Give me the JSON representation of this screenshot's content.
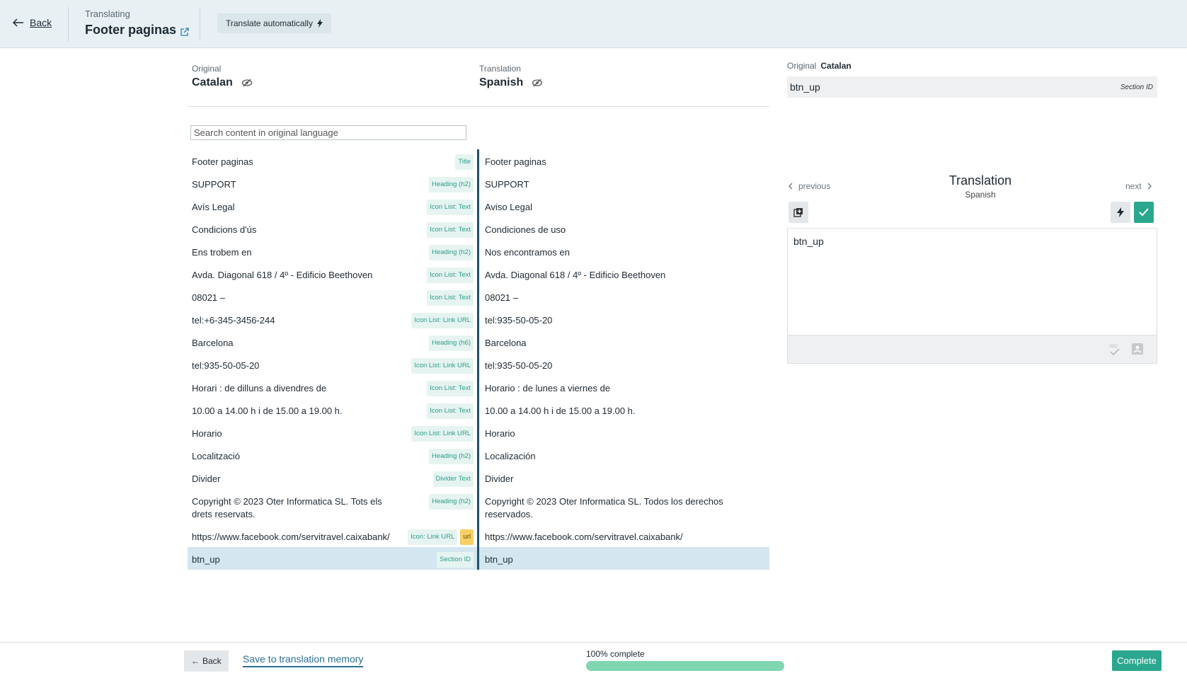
{
  "header": {
    "back_label": "Back",
    "subtitle": "Translating",
    "title": "Footer paginas",
    "translate_auto_label": "Translate automatically"
  },
  "columns": {
    "original_label": "Original",
    "original_lang": "Catalan",
    "translation_label": "Translation",
    "translation_lang": "Spanish"
  },
  "search": {
    "placeholder": "Search content in original language"
  },
  "rows": [
    {
      "original": "Footer paginas",
      "tags": [
        "Title"
      ],
      "translation": "Footer paginas"
    },
    {
      "original": "SUPPORT",
      "tags": [
        "Heading (h2)"
      ],
      "translation": "SUPPORT"
    },
    {
      "original": "Avís Legal",
      "tags": [
        "Icon List: Text"
      ],
      "translation": "Aviso Legal"
    },
    {
      "original": "Condicions d'ús",
      "tags": [
        "Icon List: Text"
      ],
      "translation": "Condiciones de uso"
    },
    {
      "original": "Ens trobem en",
      "tags": [
        "Heading (h2)"
      ],
      "translation": "Nos encontramos en"
    },
    {
      "original": "Avda. Diagonal 618 / 4º - Edificio Beethoven",
      "tags": [
        "Icon List: Text"
      ],
      "translation": "Avda. Diagonal 618 / 4º - Edificio Beethoven"
    },
    {
      "original": "08021 –",
      "tags": [
        "Icon List: Text"
      ],
      "translation": "08021 –"
    },
    {
      "original": "tel:+6-345-3456-244",
      "tags": [
        "Icon List: Link URL"
      ],
      "translation": "tel:935-50-05-20"
    },
    {
      "original": "Barcelona",
      "tags": [
        "Heading (h6)"
      ],
      "translation": "Barcelona"
    },
    {
      "original": "tel:935-50-05-20",
      "tags": [
        "Icon List: Link URL"
      ],
      "translation": "tel:935-50-05-20"
    },
    {
      "original": "Horari : de dilluns a divendres de",
      "tags": [
        "Icon List: Text"
      ],
      "translation": "Horario : de lunes a viernes de"
    },
    {
      "original": "10.00 a 14.00 h i de 15.00 a 19.00 h.",
      "tags": [
        "Icon List: Text"
      ],
      "translation": "10.00 a 14.00 h i de 15.00 a 19.00 h."
    },
    {
      "original": "Horario",
      "tags": [
        "Icon List: Link URL"
      ],
      "translation": "Horario"
    },
    {
      "original": "Localització",
      "tags": [
        "Heading (h2)"
      ],
      "translation": "Localización"
    },
    {
      "original": "Divider",
      "tags": [
        "Divider Text"
      ],
      "translation": "Divider"
    },
    {
      "original": "Copyright © 2023 Oter Informatica SL. Tots els drets reservats.",
      "tags": [
        "Heading (h2)"
      ],
      "translation": "Copyright © 2023 Oter Informatica SL. Todos los derechos reservados."
    },
    {
      "original": "https://www.facebook.com/servitravel.caixabank/",
      "tags": [
        "Icon: Link URL",
        "url"
      ],
      "translation": "https://www.facebook.com/servitravel.caixabank/"
    },
    {
      "original": "btn_up",
      "tags": [
        "Section ID"
      ],
      "translation": "btn_up",
      "selected": true
    }
  ],
  "right_panel": {
    "original_label": "Original",
    "original_lang": "Catalan",
    "original_value": "btn_up",
    "original_type": "Section ID",
    "previous_label": "previous",
    "next_label": "next",
    "translation_title": "Translation",
    "translation_lang": "Spanish",
    "translation_value": "btn_up"
  },
  "footer": {
    "back_label": "Back",
    "save_label": "Save to translation memory",
    "progress_label": "100% complete",
    "progress_fraction": 1.0,
    "complete_label": "Complete"
  },
  "colors": {
    "accent": "#2ba78f",
    "link": "#2a6f97",
    "selected_row": "#d4e6f0",
    "progress": "#7fd6b0"
  }
}
